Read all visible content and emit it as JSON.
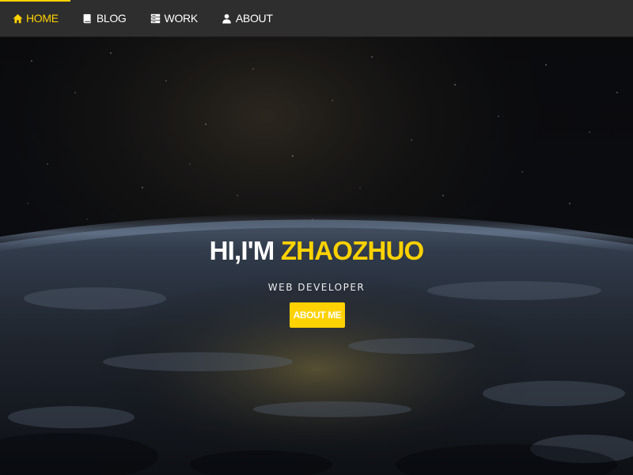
{
  "nav": {
    "items": [
      {
        "label": "HOME",
        "icon": "home-icon",
        "active": true
      },
      {
        "label": "BLOG",
        "icon": "book-icon",
        "active": false
      },
      {
        "label": "WORK",
        "icon": "server-icon",
        "active": false
      },
      {
        "label": "ABOUT",
        "icon": "user-icon",
        "active": false
      }
    ]
  },
  "hero": {
    "title_prefix": "HI,I'M ",
    "title_name": "ZHAOZHUO",
    "subtitle": "WEB DEVELOPER",
    "cta_label": "ABOUT ME"
  },
  "colors": {
    "accent": "#ffd200",
    "navbar_bg": "#2e2e2e",
    "text": "#ffffff"
  }
}
